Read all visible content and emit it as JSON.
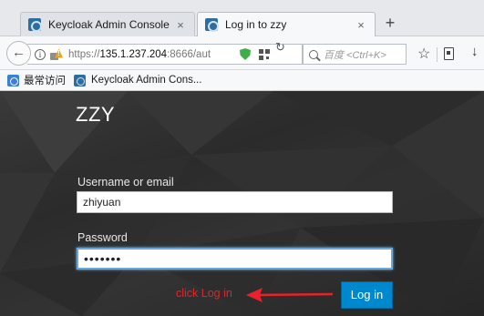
{
  "browser": {
    "tabs": [
      {
        "label": "Keycloak Admin Console",
        "active": false
      },
      {
        "label": "Log in to zzy",
        "active": true
      }
    ],
    "new_tab_label": "+",
    "close_glyph": "×",
    "url_prefix": "https://",
    "url_host": "135.1.237.204",
    "url_rest": ":8666/aut",
    "search_placeholder": "百度 <Ctrl+K>",
    "bookmarks": [
      {
        "label": "最常访问",
        "icon": "most-visited-icon"
      },
      {
        "label": "Keycloak Admin Cons...",
        "icon": "keycloak-icon"
      }
    ]
  },
  "login": {
    "realm_name": "ZZY",
    "username_label": "Username or email",
    "username_value": "zhiyuan",
    "password_label": "Password",
    "password_value": "•••••••",
    "submit_label": "Log in"
  },
  "annotation": {
    "text": "click Log in",
    "color": "#e8212a"
  },
  "colors": {
    "button": "#0088ce",
    "page_background": "#2f2f2f"
  }
}
